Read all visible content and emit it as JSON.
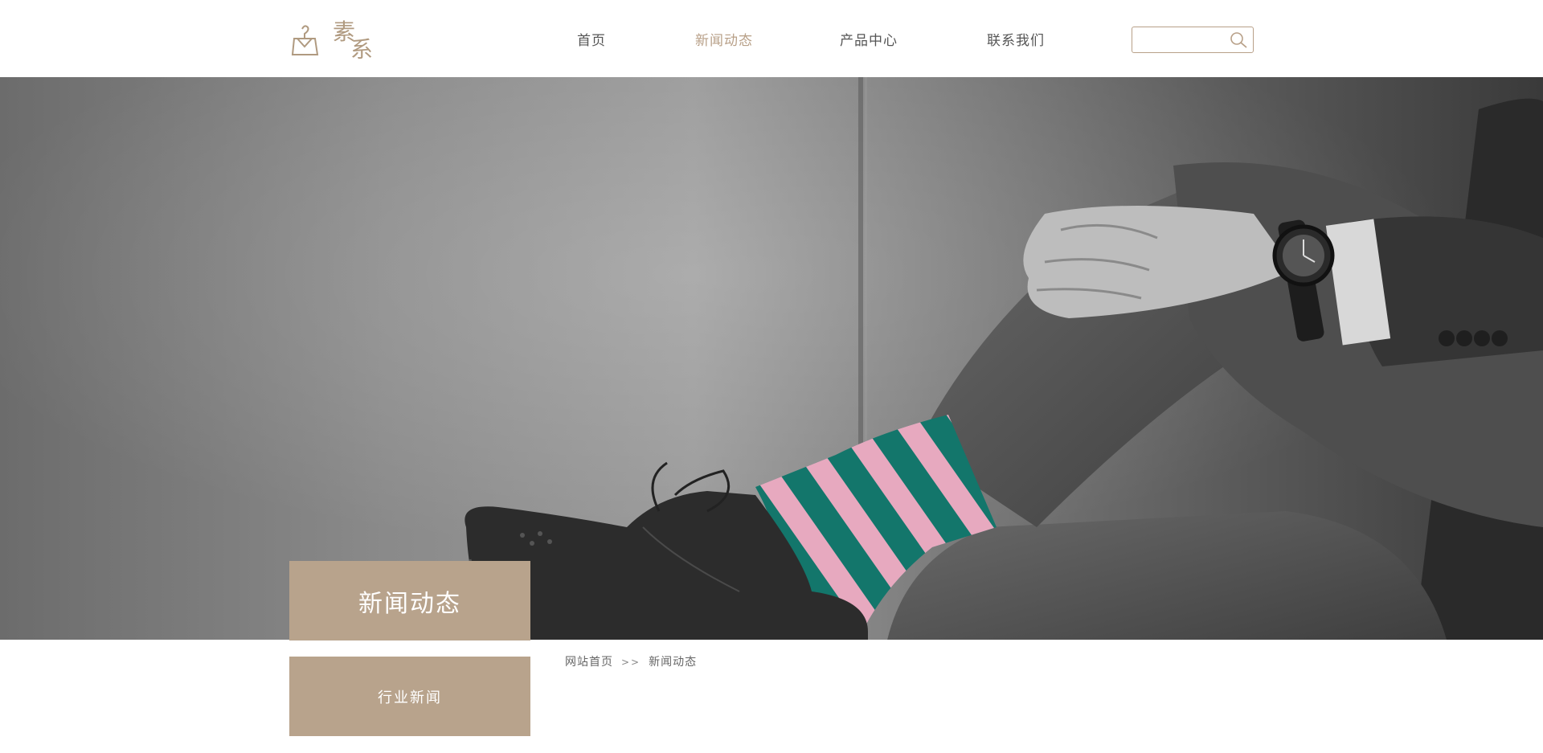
{
  "header": {
    "logo_chars": [
      "素",
      "系"
    ],
    "accent_color": "#b8a088",
    "nav": [
      {
        "label": "首页",
        "active": false
      },
      {
        "label": "新闻动态",
        "active": true
      },
      {
        "label": "产品中心",
        "active": false
      },
      {
        "label": "联系我们",
        "active": false
      }
    ],
    "search": {
      "value": "",
      "placeholder": "",
      "icon": "search-icon"
    }
  },
  "banner": {
    "title": "新闻动态"
  },
  "sidebar": {
    "items": [
      {
        "label": "行业新闻"
      }
    ],
    "block_color": "#b8a38c"
  },
  "breadcrumb": {
    "home": "网站首页",
    "separator": ">>",
    "current": "新闻动态"
  }
}
